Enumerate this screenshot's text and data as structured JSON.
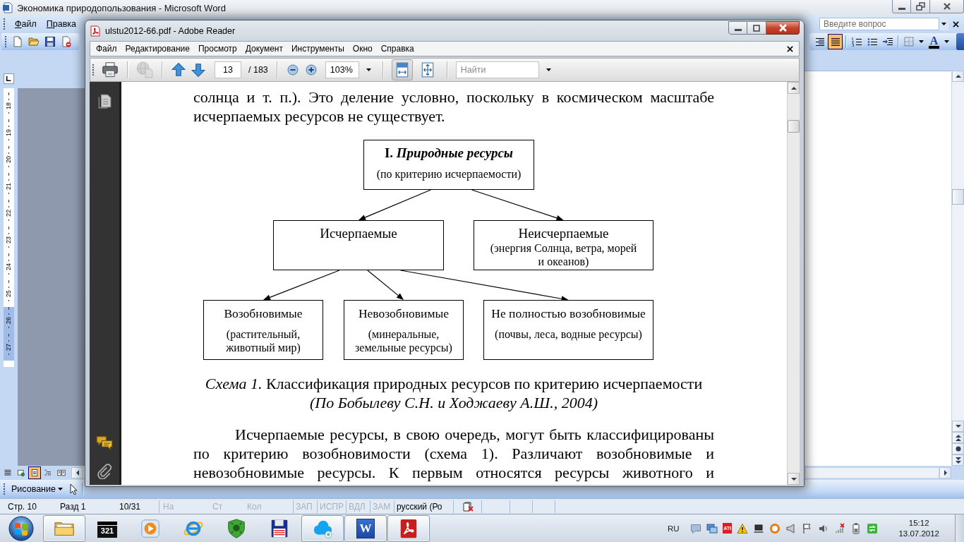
{
  "word": {
    "title": "Экономика природопользования - Microsoft Word",
    "menu": [
      "Файл",
      "Правка"
    ],
    "help_box": {
      "placeholder": "Введите вопрос"
    },
    "formatting_toolbar": [
      {
        "kind": "align-right",
        "selected": false
      },
      {
        "kind": "justify",
        "selected": true
      },
      {
        "kind": "numbering",
        "selected": false
      },
      {
        "kind": "bullets",
        "selected": false
      },
      {
        "kind": "indent",
        "selected": false
      },
      {
        "kind": "borders",
        "selected": false
      },
      {
        "kind": "font-color",
        "selected": false,
        "label": "A"
      }
    ],
    "ruler": [
      {
        "label": "18",
        "margin": false
      },
      {
        "label": "19",
        "margin": false
      },
      {
        "label": "20",
        "margin": false
      },
      {
        "label": "21",
        "margin": false
      },
      {
        "label": "22",
        "margin": false
      },
      {
        "label": "23",
        "margin": false
      },
      {
        "label": "24",
        "margin": false
      },
      {
        "label": "25",
        "margin": false
      },
      {
        "label": "26",
        "margin": true
      },
      {
        "label": "27",
        "margin": true
      }
    ],
    "view_buttons": [
      {
        "kind": "normal",
        "selected": false
      },
      {
        "kind": "web",
        "selected": false
      },
      {
        "kind": "print",
        "selected": true
      },
      {
        "kind": "outline",
        "selected": false
      },
      {
        "kind": "reading",
        "selected": false
      }
    ],
    "drawing_toolbar": {
      "label": "Рисование"
    },
    "status_bar": [
      {
        "fields": [
          {
            "text": "Стр. 10",
            "disabled": false
          },
          {
            "text": "Разд 1",
            "disabled": false
          },
          {
            "text": "10/31",
            "disabled": false
          }
        ]
      },
      {
        "fields": [
          {
            "text": "На",
            "disabled": true
          },
          {
            "text": "Ст",
            "disabled": true
          },
          {
            "text": "Кол",
            "disabled": true
          }
        ]
      },
      {
        "fields": [
          {
            "text": "ЗАП",
            "disabled": true
          }
        ]
      },
      {
        "fields": [
          {
            "text": "ИСПР",
            "disabled": true
          }
        ]
      },
      {
        "fields": [
          {
            "text": "ВДЛ",
            "disabled": true
          }
        ]
      },
      {
        "fields": [
          {
            "text": "ЗАМ",
            "disabled": true
          }
        ]
      },
      {
        "fields": [
          {
            "text": "русский (Ро",
            "disabled": false
          }
        ]
      }
    ]
  },
  "reader": {
    "title": "ulstu2012-66.pdf - Adobe Reader",
    "menu": [
      "Файл",
      "Редактирование",
      "Просмотр",
      "Документ",
      "Инструменты",
      "Окно",
      "Справка"
    ],
    "toolbar": {
      "tools": [
        {
          "kind": "print",
          "disabled": false
        },
        {
          "kind": "share",
          "disabled": true
        }
      ],
      "navigation": [
        {
          "kind": "previous-page",
          "disabled": false
        },
        {
          "kind": "next-page",
          "disabled": false
        }
      ],
      "page": "13",
      "page_count": "/ 183",
      "zoom_tools": [
        {
          "kind": "zoom-out",
          "disabled": false
        },
        {
          "kind": "zoom-in",
          "disabled": false
        }
      ],
      "zoom": "103%",
      "fit": [
        {
          "kind": "fit-width",
          "selected": true
        },
        {
          "kind": "fit-page",
          "selected": false
        }
      ],
      "find": {
        "placeholder": "Найти"
      }
    },
    "document": {
      "intro": "солнца и т. п.). Это деление условно, поскольку в космическом масштабе исчерпаемых ресурсов не существует.",
      "diagram": {
        "title": "I. *Природные ресурсы*",
        "note": "(по критерию исчерпаемости)",
        "children": [
          {
            "title": "Исчерпаемые",
            "children": [
              {
                "title": "Возобновимые",
                "note": "(растительный, животный мир)"
              },
              {
                "title": "Невозобновимые",
                "note": "(минеральные, земельные ресурсы)"
              },
              {
                "title": "Не полностью возобновимые",
                "note": "(почвы, леса, водные ресурсы)"
              }
            ]
          },
          {
            "title": "Неисчерпаемые",
            "note": "(энергия Солнца, ветра, морей и океанов)"
          }
        ]
      },
      "caption": {
        "title": "*Схема 1.* Классификация природных ресурсов по критерию исчерпаемости",
        "source": "(По Бобылеву С.Н. и Ходжаеву А.Ш., 2004)"
      },
      "body": "Исчерпаемые ресурсы, в свою очередь, могут быть классифицированы по критерию возобновимости (схема 1). Различают возобновимые и невозобновимые ресурсы. К первым относятся ресурсы животного и"
    }
  },
  "taskbar": {
    "apps": [
      {
        "kind": "folder",
        "running": true
      },
      {
        "kind": "clapperboard",
        "running": false,
        "label": "321"
      },
      {
        "kind": "media",
        "running": false
      },
      {
        "kind": "browser",
        "running": false
      },
      {
        "kind": "shield",
        "running": false
      },
      {
        "kind": "floppy",
        "running": false
      },
      {
        "kind": "cloud",
        "running": true
      },
      {
        "kind": "word",
        "running": true,
        "label": "W"
      },
      {
        "kind": "pdf",
        "running": true
      }
    ],
    "language": "RU",
    "tray": [
      {
        "kind": "chat"
      },
      {
        "kind": "network"
      },
      {
        "kind": "tile",
        "label": "ATI"
      },
      {
        "kind": "warning"
      },
      {
        "kind": "laptop"
      },
      {
        "kind": "ring"
      },
      {
        "kind": "megaphone"
      },
      {
        "kind": "flag"
      },
      {
        "kind": "speaker"
      },
      {
        "kind": "signal"
      },
      {
        "kind": "battery"
      },
      {
        "kind": "sync"
      }
    ],
    "time": "15:12",
    "date": "13.07.2012"
  }
}
